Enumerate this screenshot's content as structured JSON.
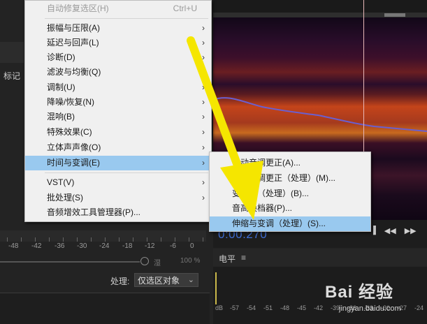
{
  "left_panel": {
    "marker_tab": "标记",
    "meter_scale": [
      "-48",
      "-42",
      "-36",
      "-30",
      "-24",
      "-18",
      "-12",
      "-6",
      "0"
    ],
    "mix_wet": "湿",
    "mix_percent": "100 %",
    "mix_level": 1.0,
    "process_label": "处理:",
    "process_value": "仅选区对象"
  },
  "right_panel": {
    "time_readout": "0:00.270",
    "level_title": "电平",
    "db_scale": [
      "dB",
      "-57",
      "-54",
      "-51",
      "-48",
      "-45",
      "-42",
      "-39",
      "-36",
      "-33",
      "-30",
      "-27",
      "-24"
    ]
  },
  "menu": {
    "items": [
      {
        "label": "自动修复选区(H)",
        "shortcut": "Ctrl+U",
        "disabled": true
      },
      {
        "label": "振幅与压限(A)",
        "submenu": true
      },
      {
        "label": "延迟与回声(L)",
        "submenu": true
      },
      {
        "label": "诊断(D)",
        "submenu": true
      },
      {
        "label": "滤波与均衡(Q)",
        "submenu": true
      },
      {
        "label": "调制(U)",
        "submenu": true
      },
      {
        "label": "降噪/恢复(N)",
        "submenu": true
      },
      {
        "label": "混响(B)",
        "submenu": true
      },
      {
        "label": "特殊效果(C)",
        "submenu": true
      },
      {
        "label": "立体声声像(O)",
        "submenu": true
      },
      {
        "label": "时间与变调(E)",
        "submenu": true,
        "highlight": true
      },
      {
        "label": "VST(V)",
        "submenu": true
      },
      {
        "label": "批处理(S)",
        "submenu": true
      },
      {
        "label": "音频增效工具管理器(P)..."
      }
    ],
    "arrow_glyph": "›"
  },
  "submenu": {
    "items": [
      {
        "label": "自动音调更正(A)..."
      },
      {
        "label": "手动音调更正（处理）(M)..."
      },
      {
        "label": "变调器（处理）(B)..."
      },
      {
        "label": "音高换档器(P)..."
      },
      {
        "label": "伸缩与变调（处理）(S)...",
        "highlight": true
      }
    ]
  },
  "watermark": {
    "logo_text": "Bai 经验",
    "url": "jingyan.baidu.com"
  },
  "colors": {
    "menu_bg": "#f0f0f0",
    "highlight": "#99c9ef",
    "arrow": "#f5e600",
    "time_blue": "#3f6fd8"
  }
}
